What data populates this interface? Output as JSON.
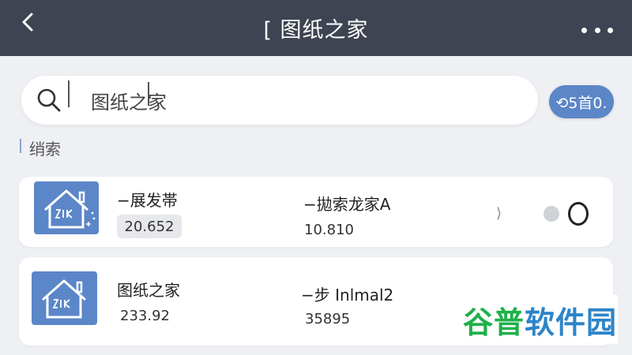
{
  "header": {
    "title": "[ 图纸之家"
  },
  "search": {
    "value": "图纸之家",
    "action_label": "⟲5首0."
  },
  "section": {
    "label": "绡索"
  },
  "cards": [
    {
      "title": "−展发帯",
      "value": "20.652",
      "subtitle": "−拋索龙家A",
      "subvalue": "10.810"
    },
    {
      "title": "图纸之家",
      "value": "233.92",
      "subtitle": "−步 Inlmal2",
      "subvalue": "35895"
    }
  ],
  "watermark": {
    "part1": "谷普",
    "part2": "软件园"
  },
  "colors": {
    "topbar": "#3f4452",
    "accent": "#5b86c8",
    "watermark_green": "#1fb04a",
    "watermark_blue": "#2c84c8"
  }
}
